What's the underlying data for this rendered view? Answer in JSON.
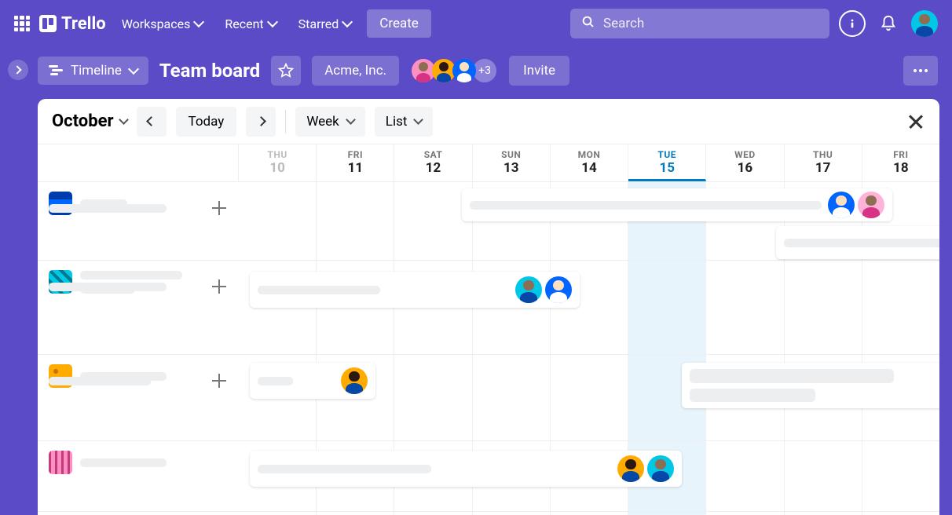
{
  "app": {
    "name": "Trello"
  },
  "nav": {
    "workspaces": "Workspaces",
    "recent": "Recent",
    "starred": "Starred",
    "create": "Create"
  },
  "search": {
    "placeholder": "Search"
  },
  "board": {
    "view_mode": "Timeline",
    "title": "Team board",
    "workspace": "Acme, Inc.",
    "extra_members": "+3",
    "invite": "Invite"
  },
  "timeline": {
    "month": "October",
    "today_label": "Today",
    "zoom": "Week",
    "group_by": "List",
    "days": [
      {
        "dow": "THU",
        "num": "10",
        "dim": true
      },
      {
        "dow": "FRI",
        "num": "11"
      },
      {
        "dow": "SAT",
        "num": "12"
      },
      {
        "dow": "SUN",
        "num": "13"
      },
      {
        "dow": "MON",
        "num": "14"
      },
      {
        "dow": "TUE",
        "num": "15",
        "today": true
      },
      {
        "dow": "WED",
        "num": "16"
      },
      {
        "dow": "THU",
        "num": "17"
      },
      {
        "dow": "FRI",
        "num": "18"
      }
    ],
    "lists": [
      {
        "color": "#0065ff"
      },
      {
        "color": "#00c7e5"
      },
      {
        "color": "#f5a623"
      },
      {
        "color": "#e668c2"
      }
    ]
  },
  "colors": {
    "brand": "#5b4bc7",
    "today": "#0079bf",
    "avatars": {
      "pink": "#ff8fc2",
      "orange": "#ffab00",
      "blue": "#0065ff",
      "cyan": "#00c7e5"
    }
  }
}
